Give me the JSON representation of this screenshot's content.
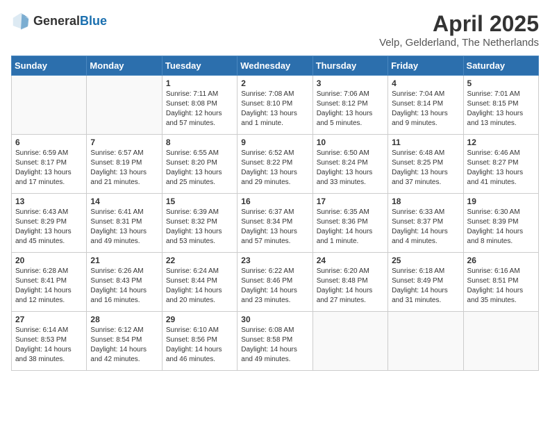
{
  "header": {
    "logo": {
      "general": "General",
      "blue": "Blue"
    },
    "title": "April 2025",
    "subtitle": "Velp, Gelderland, The Netherlands"
  },
  "days_of_week": [
    "Sunday",
    "Monday",
    "Tuesday",
    "Wednesday",
    "Thursday",
    "Friday",
    "Saturday"
  ],
  "weeks": [
    [
      {
        "day": "",
        "sunrise": "",
        "sunset": "",
        "daylight": ""
      },
      {
        "day": "",
        "sunrise": "",
        "sunset": "",
        "daylight": ""
      },
      {
        "day": "1",
        "sunrise": "Sunrise: 7:11 AM",
        "sunset": "Sunset: 8:08 PM",
        "daylight": "Daylight: 12 hours and 57 minutes."
      },
      {
        "day": "2",
        "sunrise": "Sunrise: 7:08 AM",
        "sunset": "Sunset: 8:10 PM",
        "daylight": "Daylight: 13 hours and 1 minute."
      },
      {
        "day": "3",
        "sunrise": "Sunrise: 7:06 AM",
        "sunset": "Sunset: 8:12 PM",
        "daylight": "Daylight: 13 hours and 5 minutes."
      },
      {
        "day": "4",
        "sunrise": "Sunrise: 7:04 AM",
        "sunset": "Sunset: 8:14 PM",
        "daylight": "Daylight: 13 hours and 9 minutes."
      },
      {
        "day": "5",
        "sunrise": "Sunrise: 7:01 AM",
        "sunset": "Sunset: 8:15 PM",
        "daylight": "Daylight: 13 hours and 13 minutes."
      }
    ],
    [
      {
        "day": "6",
        "sunrise": "Sunrise: 6:59 AM",
        "sunset": "Sunset: 8:17 PM",
        "daylight": "Daylight: 13 hours and 17 minutes."
      },
      {
        "day": "7",
        "sunrise": "Sunrise: 6:57 AM",
        "sunset": "Sunset: 8:19 PM",
        "daylight": "Daylight: 13 hours and 21 minutes."
      },
      {
        "day": "8",
        "sunrise": "Sunrise: 6:55 AM",
        "sunset": "Sunset: 8:20 PM",
        "daylight": "Daylight: 13 hours and 25 minutes."
      },
      {
        "day": "9",
        "sunrise": "Sunrise: 6:52 AM",
        "sunset": "Sunset: 8:22 PM",
        "daylight": "Daylight: 13 hours and 29 minutes."
      },
      {
        "day": "10",
        "sunrise": "Sunrise: 6:50 AM",
        "sunset": "Sunset: 8:24 PM",
        "daylight": "Daylight: 13 hours and 33 minutes."
      },
      {
        "day": "11",
        "sunrise": "Sunrise: 6:48 AM",
        "sunset": "Sunset: 8:25 PM",
        "daylight": "Daylight: 13 hours and 37 minutes."
      },
      {
        "day": "12",
        "sunrise": "Sunrise: 6:46 AM",
        "sunset": "Sunset: 8:27 PM",
        "daylight": "Daylight: 13 hours and 41 minutes."
      }
    ],
    [
      {
        "day": "13",
        "sunrise": "Sunrise: 6:43 AM",
        "sunset": "Sunset: 8:29 PM",
        "daylight": "Daylight: 13 hours and 45 minutes."
      },
      {
        "day": "14",
        "sunrise": "Sunrise: 6:41 AM",
        "sunset": "Sunset: 8:31 PM",
        "daylight": "Daylight: 13 hours and 49 minutes."
      },
      {
        "day": "15",
        "sunrise": "Sunrise: 6:39 AM",
        "sunset": "Sunset: 8:32 PM",
        "daylight": "Daylight: 13 hours and 53 minutes."
      },
      {
        "day": "16",
        "sunrise": "Sunrise: 6:37 AM",
        "sunset": "Sunset: 8:34 PM",
        "daylight": "Daylight: 13 hours and 57 minutes."
      },
      {
        "day": "17",
        "sunrise": "Sunrise: 6:35 AM",
        "sunset": "Sunset: 8:36 PM",
        "daylight": "Daylight: 14 hours and 1 minute."
      },
      {
        "day": "18",
        "sunrise": "Sunrise: 6:33 AM",
        "sunset": "Sunset: 8:37 PM",
        "daylight": "Daylight: 14 hours and 4 minutes."
      },
      {
        "day": "19",
        "sunrise": "Sunrise: 6:30 AM",
        "sunset": "Sunset: 8:39 PM",
        "daylight": "Daylight: 14 hours and 8 minutes."
      }
    ],
    [
      {
        "day": "20",
        "sunrise": "Sunrise: 6:28 AM",
        "sunset": "Sunset: 8:41 PM",
        "daylight": "Daylight: 14 hours and 12 minutes."
      },
      {
        "day": "21",
        "sunrise": "Sunrise: 6:26 AM",
        "sunset": "Sunset: 8:43 PM",
        "daylight": "Daylight: 14 hours and 16 minutes."
      },
      {
        "day": "22",
        "sunrise": "Sunrise: 6:24 AM",
        "sunset": "Sunset: 8:44 PM",
        "daylight": "Daylight: 14 hours and 20 minutes."
      },
      {
        "day": "23",
        "sunrise": "Sunrise: 6:22 AM",
        "sunset": "Sunset: 8:46 PM",
        "daylight": "Daylight: 14 hours and 23 minutes."
      },
      {
        "day": "24",
        "sunrise": "Sunrise: 6:20 AM",
        "sunset": "Sunset: 8:48 PM",
        "daylight": "Daylight: 14 hours and 27 minutes."
      },
      {
        "day": "25",
        "sunrise": "Sunrise: 6:18 AM",
        "sunset": "Sunset: 8:49 PM",
        "daylight": "Daylight: 14 hours and 31 minutes."
      },
      {
        "day": "26",
        "sunrise": "Sunrise: 6:16 AM",
        "sunset": "Sunset: 8:51 PM",
        "daylight": "Daylight: 14 hours and 35 minutes."
      }
    ],
    [
      {
        "day": "27",
        "sunrise": "Sunrise: 6:14 AM",
        "sunset": "Sunset: 8:53 PM",
        "daylight": "Daylight: 14 hours and 38 minutes."
      },
      {
        "day": "28",
        "sunrise": "Sunrise: 6:12 AM",
        "sunset": "Sunset: 8:54 PM",
        "daylight": "Daylight: 14 hours and 42 minutes."
      },
      {
        "day": "29",
        "sunrise": "Sunrise: 6:10 AM",
        "sunset": "Sunset: 8:56 PM",
        "daylight": "Daylight: 14 hours and 46 minutes."
      },
      {
        "day": "30",
        "sunrise": "Sunrise: 6:08 AM",
        "sunset": "Sunset: 8:58 PM",
        "daylight": "Daylight: 14 hours and 49 minutes."
      },
      {
        "day": "",
        "sunrise": "",
        "sunset": "",
        "daylight": ""
      },
      {
        "day": "",
        "sunrise": "",
        "sunset": "",
        "daylight": ""
      },
      {
        "day": "",
        "sunrise": "",
        "sunset": "",
        "daylight": ""
      }
    ]
  ]
}
